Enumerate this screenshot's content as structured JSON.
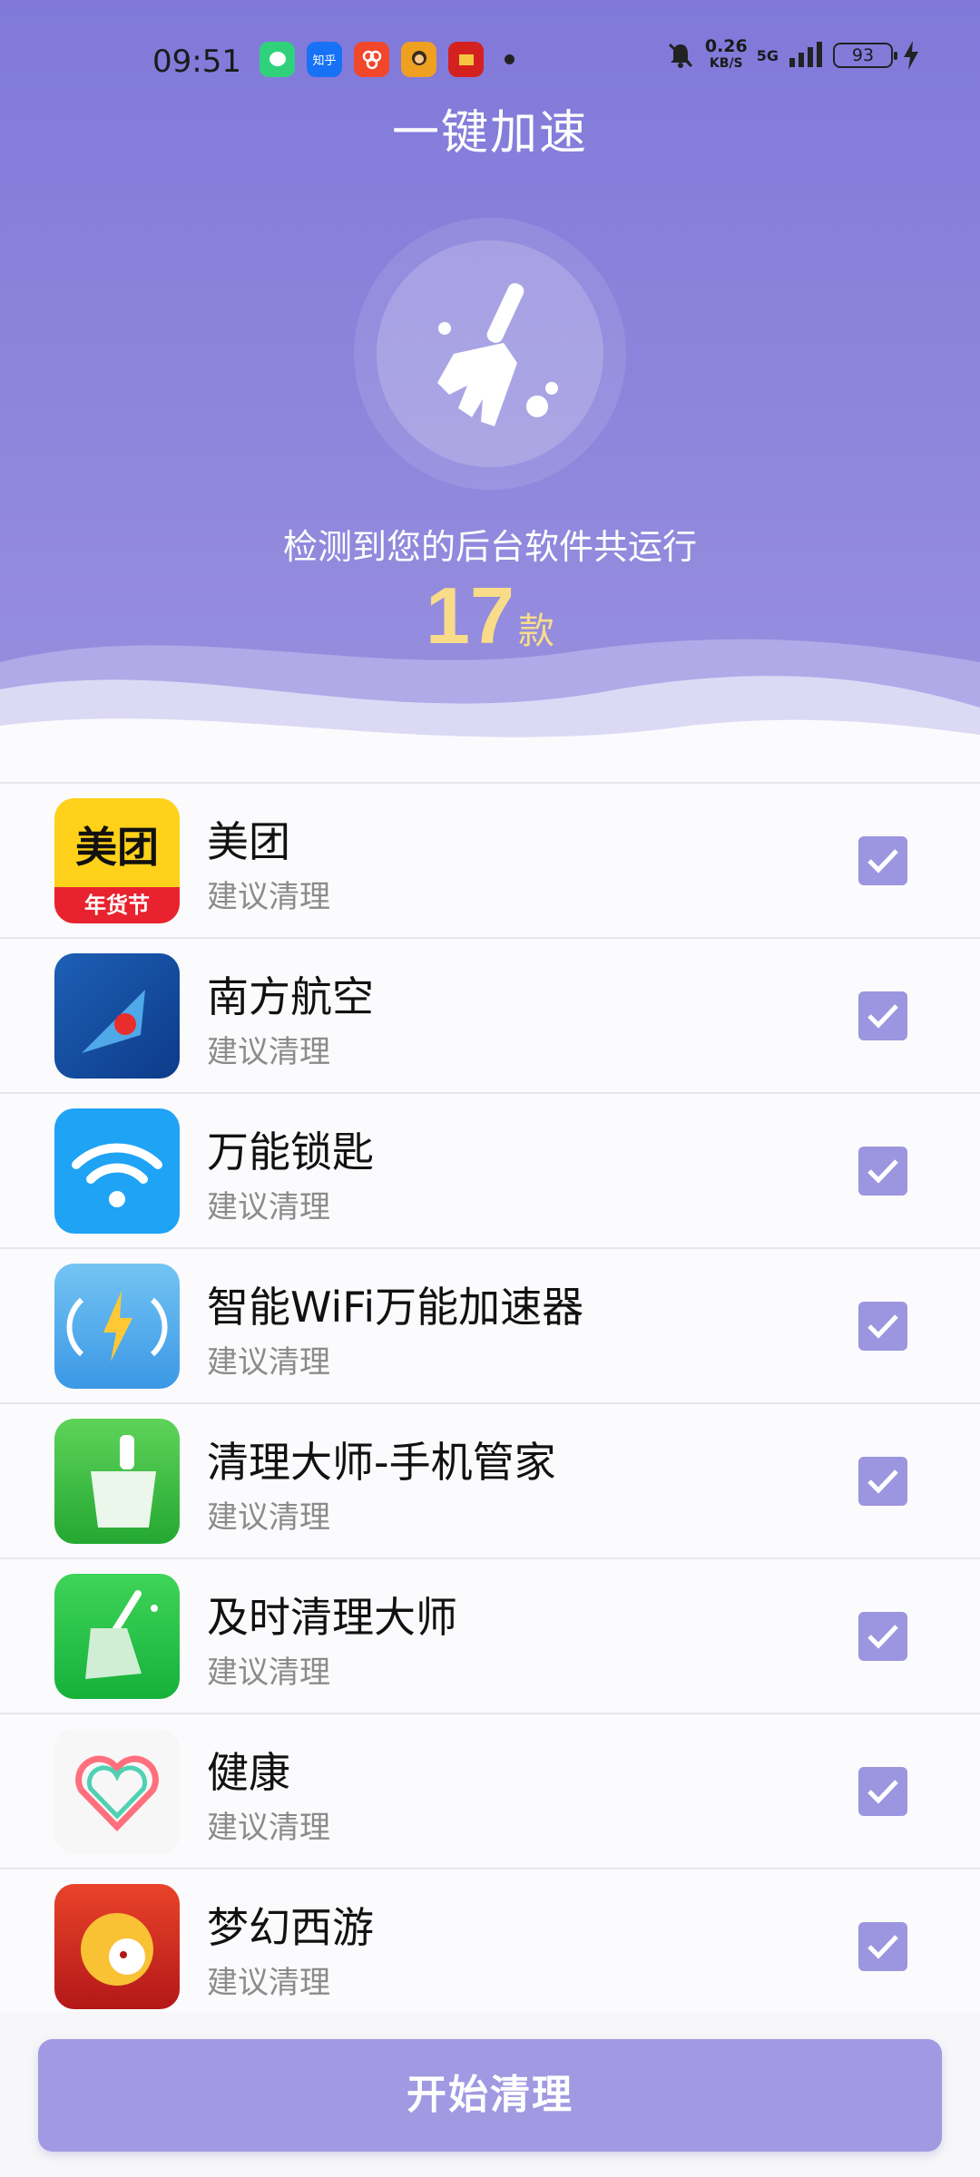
{
  "status_bar": {
    "time": "09:51",
    "net_speed": "0.26",
    "net_unit": "KB/S",
    "network": "5G",
    "battery": "93",
    "notifications": [
      {
        "name": "message-app-icon",
        "label": "",
        "color": "#2fd27b"
      },
      {
        "name": "zhihu-icon",
        "label": "知乎",
        "color": "#1772f6"
      },
      {
        "name": "app-orange-icon",
        "label": "",
        "color": "#f2472b"
      },
      {
        "name": "app-avatar-icon",
        "label": "",
        "color": "#f0a020"
      },
      {
        "name": "app-red-icon",
        "label": "",
        "color": "#d52020"
      }
    ]
  },
  "header": {
    "title": "一键加速",
    "detect_text": "检测到您的后台软件共运行",
    "count": "17",
    "count_unit": "款"
  },
  "apps": [
    {
      "name": "美团",
      "sub": "建议清理",
      "icon": "meituan-icon",
      "checked": true
    },
    {
      "name": "南方航空",
      "sub": "建议清理",
      "icon": "china-southern-icon",
      "checked": true
    },
    {
      "name": "万能锁匙",
      "sub": "建议清理",
      "icon": "wifi-key-icon",
      "checked": true
    },
    {
      "name": "智能WiFi万能加速器",
      "sub": "建议清理",
      "icon": "wifi-booster-icon",
      "checked": true
    },
    {
      "name": "清理大师-手机管家",
      "sub": "建议清理",
      "icon": "clean-master-icon",
      "checked": true
    },
    {
      "name": "及时清理大师",
      "sub": "建议清理",
      "icon": "timely-cleaner-icon",
      "checked": true
    },
    {
      "name": "健康",
      "sub": "建议清理",
      "icon": "health-icon",
      "checked": true
    },
    {
      "name": "梦幻西游",
      "sub": "建议清理",
      "icon": "fantasy-westward-icon",
      "checked": true
    }
  ],
  "meituan_icon_text": {
    "top": "美团",
    "bottom": "年货节"
  },
  "action": {
    "clean_label": "开始清理"
  },
  "colors": {
    "header": "#8079d9",
    "accent": "#9c95df",
    "count": "#f8dc8a",
    "button": "#a199e1"
  }
}
